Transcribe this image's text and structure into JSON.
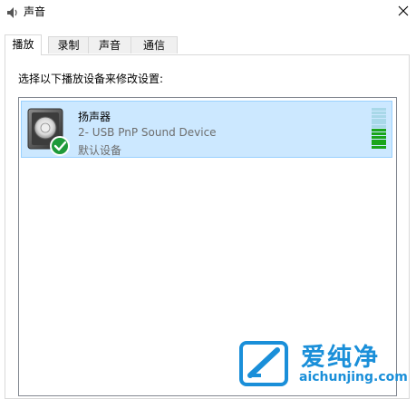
{
  "window": {
    "title": "声音",
    "icon": "speaker-icon"
  },
  "tabs": [
    {
      "label": "播放",
      "active": true
    },
    {
      "label": "录制",
      "active": false
    },
    {
      "label": "声音",
      "active": false
    },
    {
      "label": "通信",
      "active": false
    }
  ],
  "instruction": "选择以下播放设备来修改设置:",
  "devices": [
    {
      "name": "扬声器",
      "description": "2- USB PnP Sound Device",
      "status": "默认设备",
      "icon": "speaker-device-icon",
      "badge": "default-checkmark-icon",
      "selected": true,
      "level_bars_total": 12,
      "level_bars_active": 6
    }
  ],
  "watermark": {
    "brand": "爱纯净",
    "url": "aichunjing.com"
  },
  "colors": {
    "selection_bg": "#cce8ff",
    "selection_border": "#99d1ff",
    "meter_active": "#1aa51a",
    "meter_inactive": "#a8d8e8",
    "check_green": "#1f9a3a",
    "watermark_blue": "#1a8fd9"
  }
}
